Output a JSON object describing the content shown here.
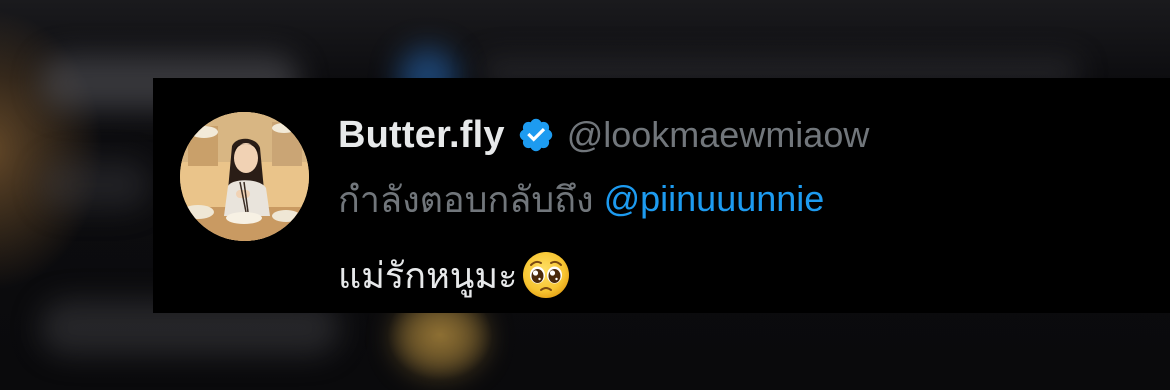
{
  "tweet": {
    "display_name": "Butter.fly",
    "handle": "@lookmaewmiaow",
    "verified": true,
    "reply_prefix": "กำลังตอบกลับถึง",
    "reply_to": "@piinuuunnie",
    "text": "แม่รักหนูมะ",
    "emoji": "pleading-face-icon"
  },
  "colors": {
    "background": "#000000",
    "name": "#e7e9ea",
    "secondary": "#71767b",
    "accent": "#1d9bf0"
  }
}
